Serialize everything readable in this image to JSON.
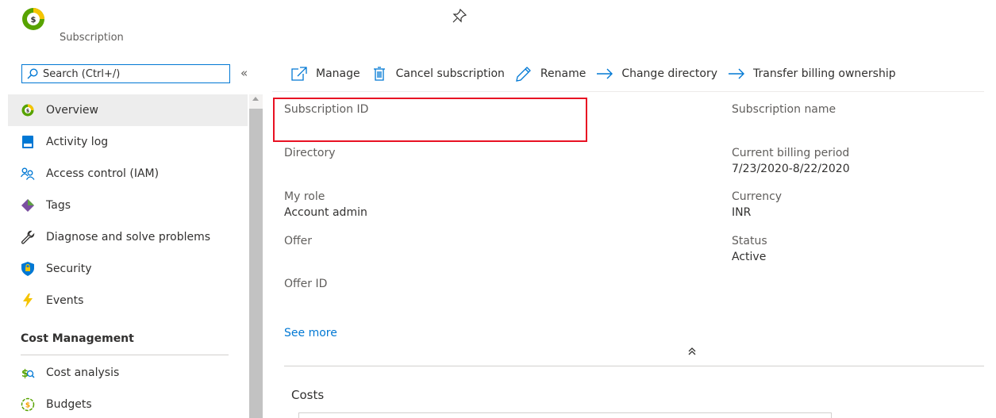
{
  "header": {
    "subtitle": "Subscription",
    "logo_color": "#57a300"
  },
  "search": {
    "placeholder": "Search (Ctrl+/)",
    "value": ""
  },
  "sidebar": {
    "collapse_label": "«",
    "items": [
      {
        "label": "Overview",
        "icon": "overview-icon",
        "active": true
      },
      {
        "label": "Activity log",
        "icon": "activity-log-icon"
      },
      {
        "label": "Access control (IAM)",
        "icon": "people-icon"
      },
      {
        "label": "Tags",
        "icon": "tag-icon"
      },
      {
        "label": "Diagnose and solve problems",
        "icon": "wrench-icon"
      },
      {
        "label": "Security",
        "icon": "shield-icon"
      },
      {
        "label": "Events",
        "icon": "lightning-icon"
      }
    ],
    "section_title": "Cost Management",
    "section_items": [
      {
        "label": "Cost analysis",
        "icon": "cost-analysis-icon"
      },
      {
        "label": "Budgets",
        "icon": "budgets-icon"
      }
    ]
  },
  "toolbar": {
    "manage": "Manage",
    "cancel": "Cancel subscription",
    "rename": "Rename",
    "change_directory": "Change directory",
    "transfer": "Transfer billing ownership"
  },
  "essentials": {
    "subscription_id": {
      "label": "Subscription ID",
      "value": ""
    },
    "subscription_name": {
      "label": "Subscription name",
      "value": ""
    },
    "directory": {
      "label": "Directory",
      "value": ""
    },
    "billing_period": {
      "label": "Current billing period",
      "value": "7/23/2020-8/22/2020"
    },
    "my_role": {
      "label": "My role",
      "value": "Account admin"
    },
    "currency": {
      "label": "Currency",
      "value": "INR"
    },
    "offer": {
      "label": "Offer",
      "value": ""
    },
    "status": {
      "label": "Status",
      "value": "Active"
    },
    "offer_id": {
      "label": "Offer ID",
      "value": ""
    },
    "see_more": "See more"
  },
  "costs": {
    "title": "Costs"
  },
  "colors": {
    "accent": "#0078d4",
    "highlight": "#e81123"
  }
}
